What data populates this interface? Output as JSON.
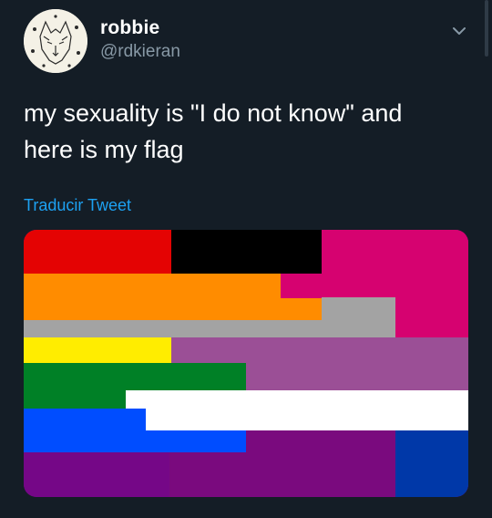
{
  "user": {
    "name": "robbie",
    "handle": "@rdkieran"
  },
  "tweet": {
    "text": "my sexuality is \"I do not know\" and\nhere is my flag",
    "translate_label": "Traducir Tweet"
  },
  "icons": {
    "menu": "chevron-down-icon",
    "avatar": "wolf-head-drawing"
  },
  "colors": {
    "background": "#141d26",
    "link": "#1da1f2",
    "secondary_text": "#8899a6",
    "flag_red": "#e40303",
    "flag_black": "#000000",
    "flag_magenta": "#d60270",
    "flag_orange": "#ff8c00",
    "flag_gray": "#a3a3a3",
    "flag_yellow": "#ffed00",
    "flag_lavender": "#9b4f96",
    "flag_green": "#008026",
    "flag_white": "#ffffff",
    "flag_blue": "#004dff",
    "flag_purple": "#750787",
    "flag_royal_blue": "#0038a8"
  }
}
